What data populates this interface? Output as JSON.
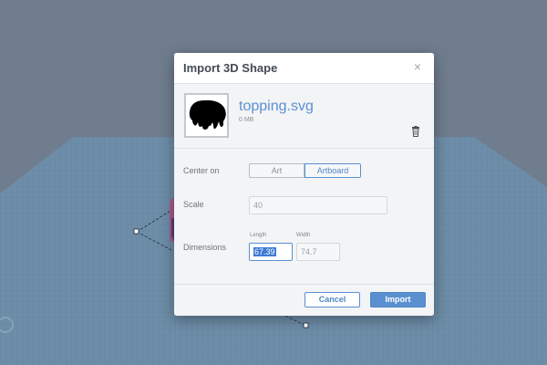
{
  "dialog": {
    "title": "Import 3D Shape",
    "close_glyph": "×",
    "file": {
      "name": "topping.svg",
      "size": "0 MB",
      "thumbnail_icon": "shape-silhouette-icon",
      "delete_icon": "trash-icon"
    },
    "center_on": {
      "label": "Center on",
      "options": [
        "Art",
        "Artboard"
      ],
      "selected": "Artboard"
    },
    "scale": {
      "label": "Scale",
      "value": "40"
    },
    "dimensions": {
      "label": "Dimensions",
      "length_label": "Length",
      "length_value": "67.39",
      "width_label": "Width",
      "width_value": "74.7"
    },
    "buttons": {
      "cancel": "Cancel",
      "import": "Import"
    }
  },
  "colors": {
    "accent": "#5a90cf",
    "workplane": "#6e8da8",
    "backdrop": "#6f7d8f"
  }
}
